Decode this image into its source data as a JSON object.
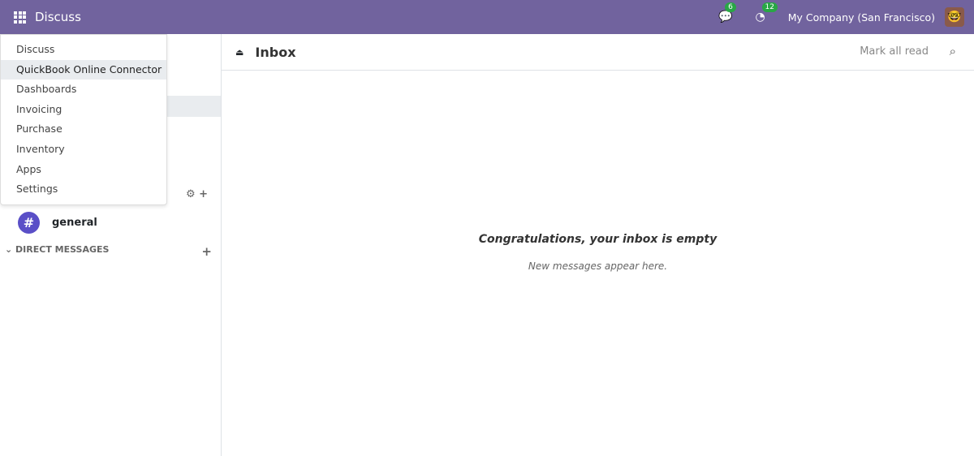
{
  "navbar": {
    "app_name": "Discuss",
    "messages_count": "6",
    "activity_count": "12",
    "company": "My Company (San Francisco)"
  },
  "app_menu": {
    "items": [
      "Discuss",
      "QuickBook Online Connector",
      "Dashboards",
      "Invoicing",
      "Purchase",
      "Inventory",
      "Apps",
      "Settings"
    ]
  },
  "sidebar": {
    "channel": "general",
    "direct_messages": "DIRECT MESSAGES"
  },
  "main": {
    "title": "Inbox",
    "mark_all_read": "Mark all read",
    "empty_title": "Congratulations, your inbox is empty",
    "empty_subtitle": "New messages appear here."
  }
}
